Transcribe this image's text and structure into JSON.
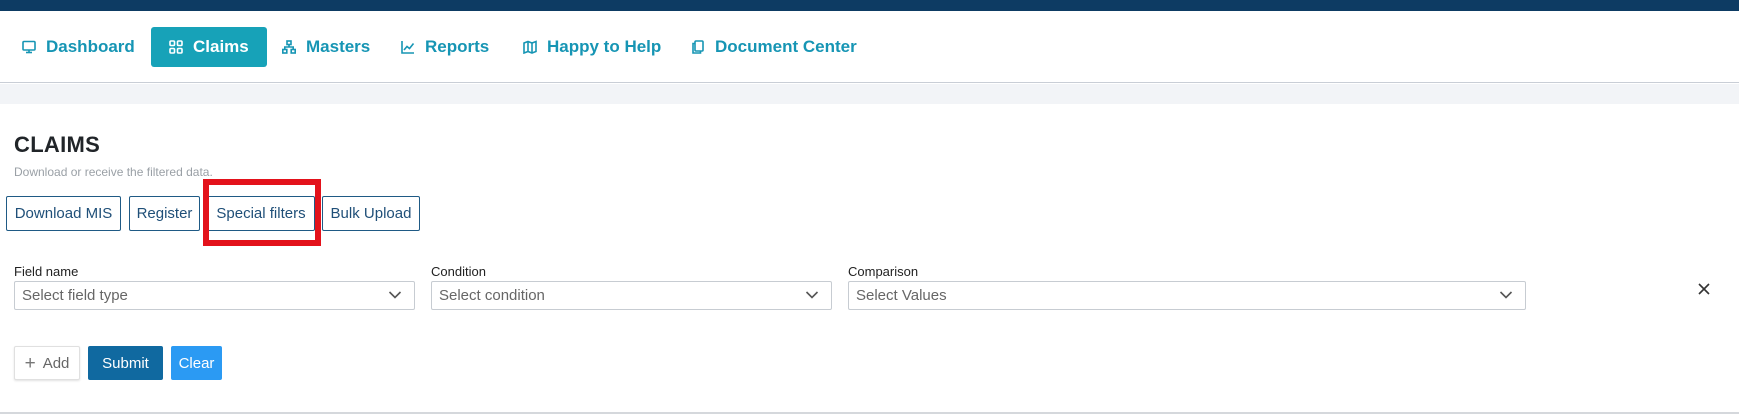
{
  "nav": {
    "items": [
      {
        "label": "Dashboard",
        "icon": "monitor-icon"
      },
      {
        "label": "Claims",
        "icon": "grid-icon",
        "active": true
      },
      {
        "label": "Masters",
        "icon": "sitemap-icon"
      },
      {
        "label": "Reports",
        "icon": "chart-line-icon"
      },
      {
        "label": "Happy to Help",
        "icon": "map-icon"
      },
      {
        "label": "Document Center",
        "icon": "documents-icon"
      }
    ]
  },
  "page": {
    "title": "CLAIMS",
    "subtitle": "Download or receive the filtered data."
  },
  "actions": {
    "download_mis": "Download MIS",
    "register": "Register",
    "special_filters": "Special filters",
    "bulk_upload": "Bulk Upload"
  },
  "filters": {
    "field_name_label": "Field name",
    "field_name_placeholder": "Select field type",
    "condition_label": "Condition",
    "condition_placeholder": "Select condition",
    "comparison_label": "Comparison",
    "comparison_placeholder": "Select Values"
  },
  "form_buttons": {
    "add": "Add",
    "submit": "Submit",
    "clear": "Clear"
  },
  "colors": {
    "primary": "#17a2b8",
    "nav_text": "#1695b4",
    "submit": "#1069a0",
    "clear": "#2b9af3",
    "highlight": "#e3121b"
  }
}
